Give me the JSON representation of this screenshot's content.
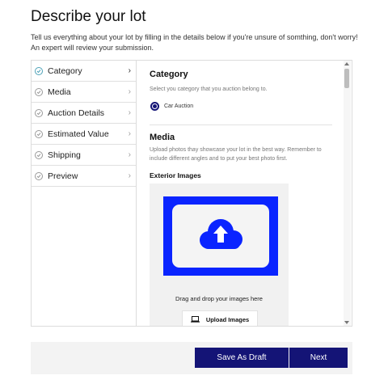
{
  "page": {
    "title": "Describe your lot",
    "intro": "Tell us everything about your lot by filling in the details below if you're unsure of somthing, don't worry! An expert will review your submission."
  },
  "nav": {
    "items": [
      {
        "label": "Category",
        "active": true
      },
      {
        "label": "Media",
        "active": false
      },
      {
        "label": "Auction Details",
        "active": false
      },
      {
        "label": "Estimated Value",
        "active": false
      },
      {
        "label": "Shipping",
        "active": false
      },
      {
        "label": "Preview",
        "active": false
      }
    ]
  },
  "category": {
    "heading": "Category",
    "description": "Select you category that you auction belong to.",
    "option_label": "Car Auction",
    "option_selected": true
  },
  "media": {
    "heading": "Media",
    "description": "Upload photos thay showcase your lot in the best way. Remember to include different angles and to put your best photo first.",
    "exterior_heading": "Exterior Images",
    "drop_text": "Drag and drop your images here",
    "upload_label": "Upload Images"
  },
  "footer": {
    "draft_label": "Save As Draft",
    "next_label": "Next"
  },
  "colors": {
    "primary": "#141476",
    "upload_blue": "#0a24ff",
    "check_teal": "#4ea2b8"
  },
  "icons": {
    "nav_status": "check-circle-icon",
    "nav_chevron": "chevron-right-icon",
    "upload_cloud": "cloud-upload-icon",
    "upload_button": "laptop-icon"
  }
}
